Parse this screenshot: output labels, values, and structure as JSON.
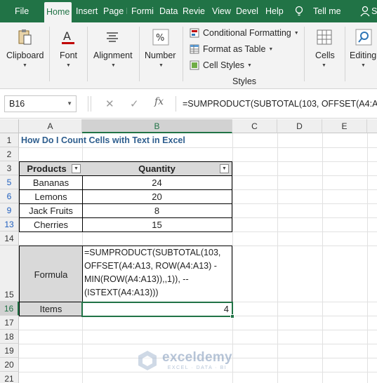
{
  "tabs": [
    "File",
    "Home",
    "Insert",
    "Page I",
    "Formi",
    "Data",
    "Revie",
    "View",
    "Devel",
    "Help",
    "Tell me",
    "S"
  ],
  "active_tab": "Home",
  "ribbon": {
    "clipboard": "Clipboard",
    "font": "Font",
    "alignment": "Alignment",
    "number": "Number",
    "conditional_formatting": "Conditional Formatting",
    "format_as_table": "Format as Table",
    "cell_styles": "Cell Styles",
    "styles_group": "Styles",
    "cells": "Cells",
    "editing": "Editing"
  },
  "formula_bar": {
    "name_box": "B16",
    "fx": "fx",
    "formula": "=SUMPRODUCT(SUBTOTAL(103, OFFSET(A4:A"
  },
  "columns": [
    "A",
    "B",
    "C",
    "D",
    "E"
  ],
  "rows": [
    "1",
    "2",
    "3",
    "5",
    "6",
    "9",
    "13",
    "14",
    "15",
    "16",
    "17",
    "18",
    "19",
    "20",
    "21"
  ],
  "sheet": {
    "title": "How Do I Count Cells with Text in Excel",
    "header_products": "Products",
    "header_quantity": "Quantity",
    "data": [
      {
        "product": "Bananas",
        "quantity": "24"
      },
      {
        "product": "Lemons",
        "quantity": "20"
      },
      {
        "product": "Jack Fruits",
        "quantity": "8"
      },
      {
        "product": "Cherries",
        "quantity": "15"
      }
    ],
    "formula_label": "Formula",
    "formula_lines": [
      "=SUMPRODUCT(SUBTOTAL(103,",
      "OFFSET(A4:A13, ROW(A4:A13) -",
      "MIN(ROW(A4:A13)),,1)), --",
      "(ISTEXT(A4:A13)))"
    ],
    "items_label": "Items",
    "items_value": "4"
  },
  "watermark": {
    "name": "exceldemy",
    "tagline": "EXCEL · DATA · BI"
  },
  "colors": {
    "excel_green": "#217346",
    "title_blue": "#2e5e8e",
    "header_gray": "#d9d9d9"
  }
}
